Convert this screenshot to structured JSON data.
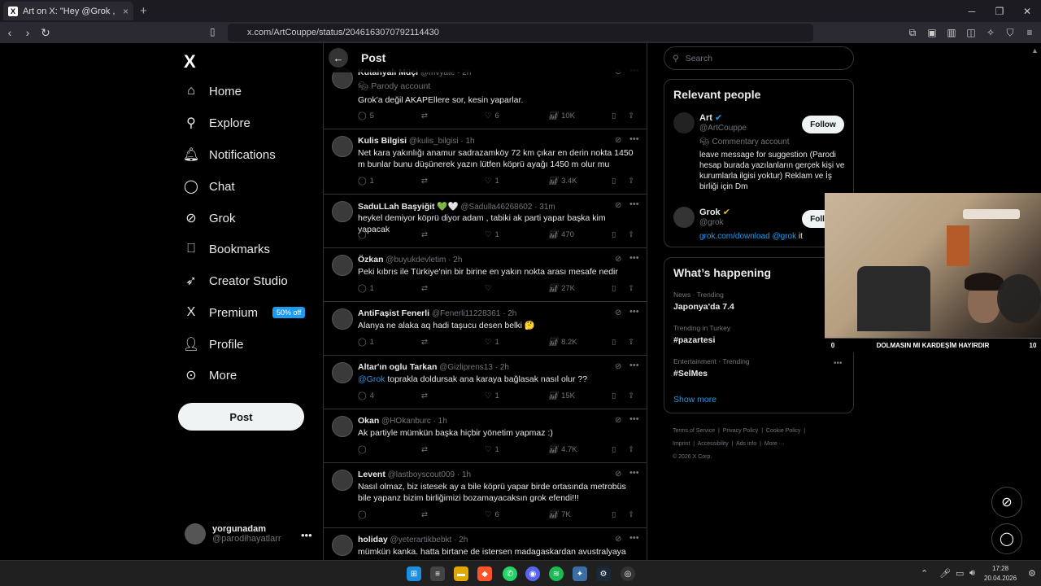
{
  "browser": {
    "tab_title": "Art on X: \"Hey @Grok , böyle bi",
    "tab_close": "×",
    "new_tab": "+",
    "url": "x.com/ArtCouppe/status/2046163070792114430"
  },
  "nav": {
    "logo": "X",
    "items": [
      {
        "label": "Home",
        "icon": "home-icon"
      },
      {
        "label": "Explore",
        "icon": "search-icon"
      },
      {
        "label": "Notifications",
        "icon": "bell-icon"
      },
      {
        "label": "Chat",
        "icon": "chat-icon"
      },
      {
        "label": "Grok",
        "icon": "grok-icon"
      },
      {
        "label": "Bookmarks",
        "icon": "bookmark-icon"
      },
      {
        "label": "Creator Studio",
        "icon": "rocket-icon"
      },
      {
        "label": "Premium",
        "icon": "x-icon"
      },
      {
        "label": "Profile",
        "icon": "person-icon"
      },
      {
        "label": "More",
        "icon": "more-circle-icon"
      }
    ],
    "premium_badge": "50% off",
    "post_button": "Post",
    "account": {
      "name": "yorgunadam",
      "handle": "@parodihayatlarr",
      "menu": "•••"
    }
  },
  "timeline": {
    "title": "Post",
    "replies": [
      {
        "name": "Kütahyalı Müçi",
        "handle": "@mvyate",
        "time": "2h",
        "parody": "Parody account",
        "text": "Grok'a değil AKAPEllere sor, kesin yaparlar.",
        "replies": "5",
        "reposts": "",
        "likes": "6",
        "views": "10K"
      },
      {
        "name": "Kulis Bilgisi",
        "handle": "@kulis_bilgisi",
        "time": "1h",
        "text": "Net kara yakınlığı anamur sadrazamköy 72 km çıkar en derin nokta 1450 m bunlar bunu düşünerek yazın lütfen köprü ayağı 1450 m olur mu",
        "replies": "1",
        "reposts": "",
        "likes": "1",
        "views": "3.4K"
      },
      {
        "name": "SaduLLah Başyiğit 💚🤍",
        "handle": "@Sadulla46268602",
        "time": "31m",
        "text": "heykel demiyor köprü diyor adam , tabiki ak parti yapar başka kim yapacak",
        "replies": "",
        "reposts": "",
        "likes": "1",
        "views": "470"
      },
      {
        "name": "Özkan",
        "handle": "@buyukdevletim",
        "time": "2h",
        "text": "Peki kıbrıs ile Türkiye'nin bir birine en yakın nokta arası mesafe nedir",
        "replies": "1",
        "reposts": "",
        "likes": "",
        "views": "27K"
      },
      {
        "name": "AntiFaşist Fenerli",
        "handle": "@Fenerli11228361",
        "time": "2h",
        "text": "Alanya ne alaka aq hadi taşucu desen belki 🤔",
        "replies": "1",
        "reposts": "",
        "likes": "1",
        "views": "8.2K"
      },
      {
        "name": "Altar'ın oglu Tarkan",
        "handle": "@Gizliprens13",
        "time": "2h",
        "mention": "@Grok",
        "text": " toprakla doldursak ana karaya bağlasak nasıl olur ??",
        "replies": "4",
        "reposts": "",
        "likes": "1",
        "views": "15K"
      },
      {
        "name": "Okan",
        "handle": "@HOkanburc",
        "time": "1h",
        "text": "Ak partiyle mümkün başka hiçbir yönetim yapmaz :)",
        "replies": "",
        "reposts": "",
        "likes": "1",
        "views": "4.7K"
      },
      {
        "name": "Levent",
        "handle": "@lastboyscout009",
        "time": "1h",
        "text": "Nasıl olmaz, biz istesek ay a bile köprü yapar birde ortasında metrobüs bile yapanz bizim birliğimizi bozamayacaksın grok efendi!!!",
        "replies": "",
        "reposts": "",
        "likes": "6",
        "views": "7K"
      },
      {
        "name": "holiday",
        "handle": "@yeterartikbebkt",
        "time": "2h",
        "text": "mümkün kanka. hatta birtane de istersen madagaskardan avustralyaya",
        "replies": "",
        "reposts": "",
        "likes": "",
        "views": ""
      }
    ]
  },
  "right": {
    "search_placeholder": "Search",
    "relevant_title": "Relevant people",
    "people": [
      {
        "name": "Art",
        "handle": "@ArtCouppe",
        "tag": "Commentary account",
        "bio": "leave message for suggestion (Parodi hesap burada yazılanların gerçek kişi ve kurumlarla ilgisi yoktur) Reklam ve İş birliği için Dm",
        "follow": "Follow"
      },
      {
        "name": "Grok",
        "handle": "@grok",
        "bio_link": "grok.com/download",
        "bio_mention": "@grok",
        "bio_end": "it",
        "follow": "Follow"
      }
    ],
    "whats_happening_title": "What’s happening",
    "trends": [
      {
        "context": "News · Trending",
        "name": "Japonya'da 7.4"
      },
      {
        "context": "Trending in Turkey",
        "name": "#pazartesi"
      },
      {
        "context": "Entertainment · Trending",
        "name": "#SelMes"
      }
    ],
    "show_more": "Show more",
    "footer": [
      "Terms of Service",
      "Privacy Policy",
      "Cookie Policy",
      "Imprint",
      "Accessibility",
      "Ads info",
      "More ···",
      "© 2026 X Corp."
    ]
  },
  "webcam": {
    "left": "0",
    "caption": "DOLMASIN MI KARDEŞİM HAYIRDIR",
    "right": "10"
  },
  "taskbar": {
    "time": "17:28",
    "date": "20.04.2026"
  }
}
